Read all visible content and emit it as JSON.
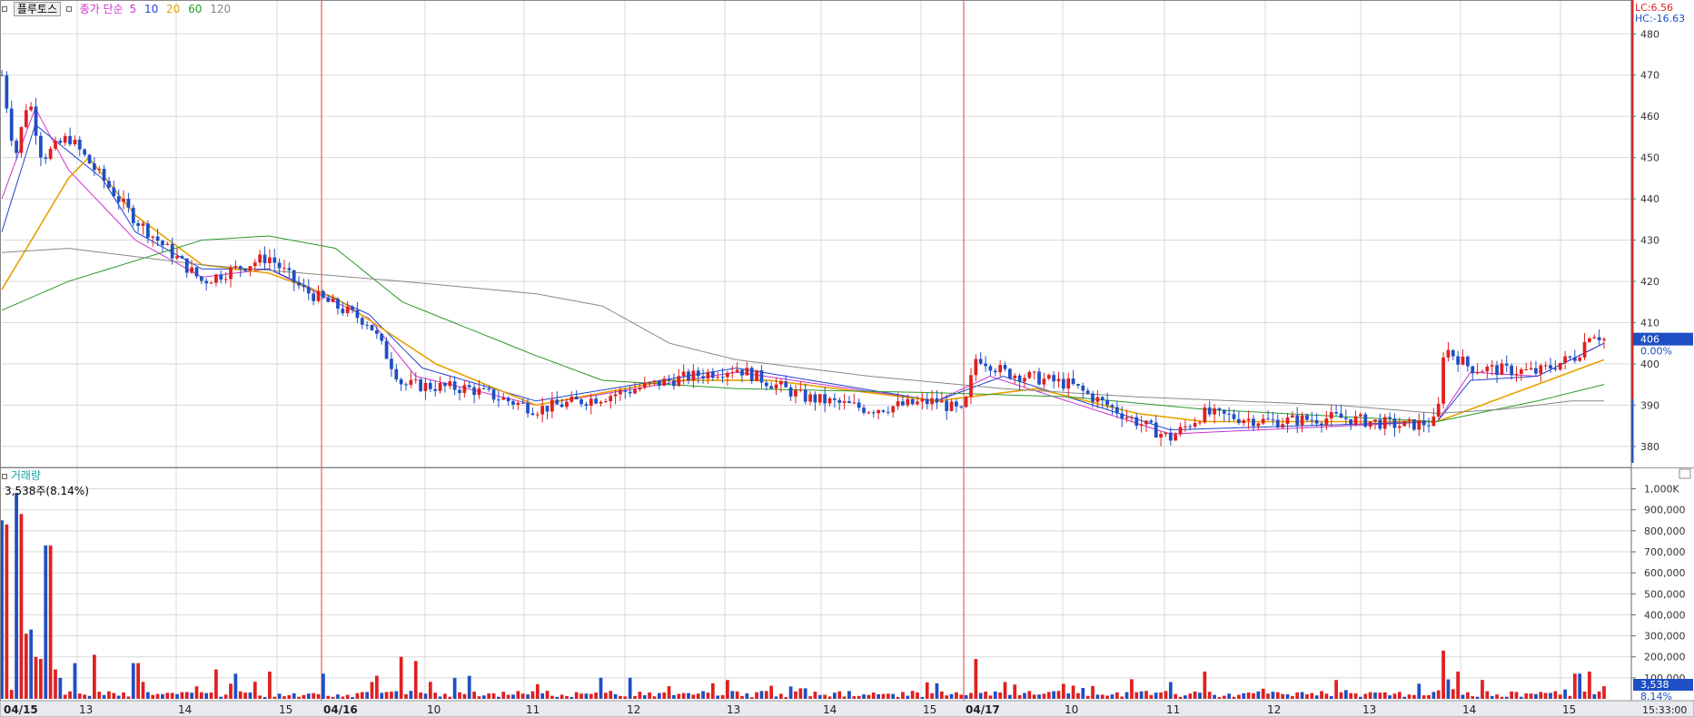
{
  "toolbar": {
    "stock_name": "플루토스",
    "ma_title": "종가 단순",
    "ma_periods": [
      "5",
      "10",
      "20",
      "60",
      "120"
    ],
    "ma_colors": [
      "#cc33cc",
      "#2244cc",
      "#e8a000",
      "#2a9a2a",
      "#888888"
    ]
  },
  "price_axis": {
    "ticks": [
      "480",
      "470",
      "460",
      "450",
      "440",
      "430",
      "420",
      "410",
      "400",
      "390",
      "380"
    ],
    "lc_label": "LC:6.56",
    "hc_label": "HC:-16.63",
    "current_price": "406",
    "current_change": "0.00%"
  },
  "volume_panel": {
    "title": "거래량",
    "current_text": "3,538주(8.14%)",
    "ticks": [
      "1,000K",
      "900,000",
      "800,000",
      "700,000",
      "600,000",
      "500,000",
      "400,000",
      "300,000",
      "200,000",
      "100,000"
    ],
    "current_value": "3,538",
    "current_pct": "8.14%"
  },
  "time_axis": {
    "labels": [
      "04/15",
      "13",
      "14",
      "15",
      "04/16",
      "10",
      "11",
      "12",
      "13",
      "14",
      "15",
      "04/17",
      "10",
      "11",
      "12",
      "13",
      "14",
      "15"
    ],
    "end_time": "15:33:00"
  },
  "colors": {
    "up": "#e02020",
    "down": "#1f4fc4",
    "grid": "#d8d8d8",
    "day_separator": "#e04040"
  },
  "chart_data": {
    "type": "candlestick",
    "ylim": [
      376,
      486
    ],
    "volume_ylim": [
      0,
      1050000
    ],
    "day_separators": [
      "04/16",
      "04/17"
    ],
    "price_anchors": [
      {
        "pos": 0.0,
        "price": 470
      },
      {
        "pos": 0.2,
        "price": 450
      },
      {
        "pos": 0.4,
        "price": 465
      },
      {
        "pos": 0.6,
        "price": 450
      },
      {
        "pos": 1.0,
        "price": 455
      },
      {
        "pos": 2.0,
        "price": 435
      },
      {
        "pos": 3.0,
        "price": 420
      },
      {
        "pos": 4.0,
        "price": 426
      },
      {
        "pos": 4.5,
        "price": 418
      },
      {
        "pos": 5.5,
        "price": 410
      },
      {
        "pos": 6.0,
        "price": 395
      },
      {
        "pos": 7.0,
        "price": 394
      },
      {
        "pos": 8.0,
        "price": 389
      },
      {
        "pos": 9.0,
        "price": 392
      },
      {
        "pos": 10.0,
        "price": 396
      },
      {
        "pos": 11.0,
        "price": 399
      },
      {
        "pos": 12.0,
        "price": 392
      },
      {
        "pos": 13.0,
        "price": 389
      },
      {
        "pos": 14.0,
        "price": 391
      },
      {
        "pos": 14.4,
        "price": 388
      },
      {
        "pos": 14.6,
        "price": 402
      },
      {
        "pos": 15.0,
        "price": 398
      },
      {
        "pos": 16.0,
        "price": 395
      },
      {
        "pos": 17.0,
        "price": 386
      },
      {
        "pos": 17.5,
        "price": 382
      },
      {
        "pos": 18.0,
        "price": 388
      },
      {
        "pos": 19.0,
        "price": 386
      },
      {
        "pos": 20.0,
        "price": 387
      },
      {
        "pos": 21.0,
        "price": 385
      },
      {
        "pos": 21.5,
        "price": 386
      },
      {
        "pos": 21.6,
        "price": 404
      },
      {
        "pos": 22.0,
        "price": 399
      },
      {
        "pos": 23.0,
        "price": 398
      },
      {
        "pos": 23.6,
        "price": 402
      },
      {
        "pos": 23.8,
        "price": 408
      },
      {
        "pos": 24.0,
        "price": 406
      }
    ],
    "ma_anchors": {
      "5": [
        {
          "pos": 0.0,
          "price": 440
        },
        {
          "pos": 0.5,
          "price": 462
        },
        {
          "pos": 1.0,
          "price": 447
        },
        {
          "pos": 2.0,
          "price": 430
        },
        {
          "pos": 3.0,
          "price": 421
        },
        {
          "pos": 4.0,
          "price": 423
        },
        {
          "pos": 5.5,
          "price": 411
        },
        {
          "pos": 6.2,
          "price": 397
        },
        {
          "pos": 8.0,
          "price": 390
        },
        {
          "pos": 11.0,
          "price": 398
        },
        {
          "pos": 14.0,
          "price": 391
        },
        {
          "pos": 14.8,
          "price": 397
        },
        {
          "pos": 17.5,
          "price": 383
        },
        {
          "pos": 21.5,
          "price": 386
        },
        {
          "pos": 22.0,
          "price": 398
        },
        {
          "pos": 23.0,
          "price": 397
        },
        {
          "pos": 24.0,
          "price": 405
        }
      ],
      "10": [
        {
          "pos": 0.0,
          "price": 432
        },
        {
          "pos": 0.5,
          "price": 458
        },
        {
          "pos": 1.5,
          "price": 445
        },
        {
          "pos": 2.0,
          "price": 432
        },
        {
          "pos": 3.0,
          "price": 423
        },
        {
          "pos": 4.0,
          "price": 423
        },
        {
          "pos": 5.5,
          "price": 412
        },
        {
          "pos": 6.3,
          "price": 399
        },
        {
          "pos": 8.0,
          "price": 391
        },
        {
          "pos": 11.0,
          "price": 399
        },
        {
          "pos": 14.0,
          "price": 391
        },
        {
          "pos": 15.0,
          "price": 397
        },
        {
          "pos": 17.5,
          "price": 384
        },
        {
          "pos": 21.5,
          "price": 386
        },
        {
          "pos": 22.0,
          "price": 396
        },
        {
          "pos": 23.0,
          "price": 397
        },
        {
          "pos": 24.0,
          "price": 405
        }
      ],
      "20": [
        {
          "pos": 0.0,
          "price": 418
        },
        {
          "pos": 1.0,
          "price": 445
        },
        {
          "pos": 1.3,
          "price": 450
        },
        {
          "pos": 2.0,
          "price": 436
        },
        {
          "pos": 3.0,
          "price": 424
        },
        {
          "pos": 4.0,
          "price": 422
        },
        {
          "pos": 5.0,
          "price": 416
        },
        {
          "pos": 6.5,
          "price": 400
        },
        {
          "pos": 8.0,
          "price": 390
        },
        {
          "pos": 10.0,
          "price": 396
        },
        {
          "pos": 11.5,
          "price": 396
        },
        {
          "pos": 14.0,
          "price": 391
        },
        {
          "pos": 15.5,
          "price": 394
        },
        {
          "pos": 17.0,
          "price": 388
        },
        {
          "pos": 18.0,
          "price": 386
        },
        {
          "pos": 21.5,
          "price": 386
        },
        {
          "pos": 22.5,
          "price": 392
        },
        {
          "pos": 23.5,
          "price": 398
        },
        {
          "pos": 24.0,
          "price": 401
        }
      ],
      "60": [
        {
          "pos": 0.0,
          "price": 413
        },
        {
          "pos": 1.0,
          "price": 420
        },
        {
          "pos": 3.0,
          "price": 430
        },
        {
          "pos": 4.0,
          "price": 431
        },
        {
          "pos": 5.0,
          "price": 428
        },
        {
          "pos": 6.0,
          "price": 415
        },
        {
          "pos": 8.0,
          "price": 402
        },
        {
          "pos": 9.0,
          "price": 396
        },
        {
          "pos": 11.0,
          "price": 394
        },
        {
          "pos": 14.0,
          "price": 393
        },
        {
          "pos": 16.0,
          "price": 392
        },
        {
          "pos": 18.0,
          "price": 389
        },
        {
          "pos": 21.5,
          "price": 386
        },
        {
          "pos": 23.0,
          "price": 391
        },
        {
          "pos": 24.0,
          "price": 395
        }
      ],
      "120": [
        {
          "pos": 0.0,
          "price": 427
        },
        {
          "pos": 1.0,
          "price": 428
        },
        {
          "pos": 3.0,
          "price": 424
        },
        {
          "pos": 6.0,
          "price": 420
        },
        {
          "pos": 8.0,
          "price": 417
        },
        {
          "pos": 9.0,
          "price": 414
        },
        {
          "pos": 10.0,
          "price": 405
        },
        {
          "pos": 11.0,
          "price": 401
        },
        {
          "pos": 13.0,
          "price": 397
        },
        {
          "pos": 15.0,
          "price": 394
        },
        {
          "pos": 17.0,
          "price": 392
        },
        {
          "pos": 20.0,
          "price": 390
        },
        {
          "pos": 21.5,
          "price": 388
        },
        {
          "pos": 22.5,
          "price": 389
        },
        {
          "pos": 23.5,
          "price": 391
        },
        {
          "pos": 24.0,
          "price": 391
        }
      ]
    },
    "volume_spikes": [
      {
        "pos": 0.0,
        "value": 850000
      },
      {
        "pos": 0.05,
        "value": 400000
      },
      {
        "pos": 0.1,
        "value": 830000
      },
      {
        "pos": 0.15,
        "value": 580000
      },
      {
        "pos": 0.2,
        "value": 480000
      },
      {
        "pos": 0.25,
        "value": 980000
      },
      {
        "pos": 0.3,
        "value": 880000
      },
      {
        "pos": 0.35,
        "value": 390000
      },
      {
        "pos": 0.4,
        "value": 310000
      },
      {
        "pos": 0.45,
        "value": 330000
      },
      {
        "pos": 0.5,
        "value": 250000
      },
      {
        "pos": 0.55,
        "value": 200000
      },
      {
        "pos": 0.6,
        "value": 190000
      },
      {
        "pos": 0.65,
        "value": 240000
      },
      {
        "pos": 0.7,
        "value": 730000
      },
      {
        "pos": 0.8,
        "value": 140000
      },
      {
        "pos": 0.9,
        "value": 120000
      },
      {
        "pos": 1.1,
        "value": 170000
      },
      {
        "pos": 1.4,
        "value": 210000
      },
      {
        "pos": 2.0,
        "value": 170000
      },
      {
        "pos": 3.2,
        "value": 140000
      },
      {
        "pos": 3.5,
        "value": 120000
      },
      {
        "pos": 4.0,
        "value": 130000
      },
      {
        "pos": 4.8,
        "value": 120000
      },
      {
        "pos": 5.6,
        "value": 110000
      },
      {
        "pos": 6.0,
        "value": 200000
      },
      {
        "pos": 6.2,
        "value": 180000
      },
      {
        "pos": 6.4,
        "value": 150000
      },
      {
        "pos": 6.8,
        "value": 100000
      },
      {
        "pos": 8.0,
        "value": 70000
      },
      {
        "pos": 10.0,
        "value": 60000
      },
      {
        "pos": 12.0,
        "value": 50000
      },
      {
        "pos": 14.6,
        "value": 190000
      },
      {
        "pos": 15.0,
        "value": 80000
      },
      {
        "pos": 17.5,
        "value": 80000
      },
      {
        "pos": 18.0,
        "value": 130000
      },
      {
        "pos": 21.6,
        "value": 230000
      },
      {
        "pos": 21.8,
        "value": 130000
      },
      {
        "pos": 22.2,
        "value": 90000
      },
      {
        "pos": 23.6,
        "value": 120000
      },
      {
        "pos": 23.8,
        "value": 130000
      },
      {
        "pos": 24.0,
        "value": 60000
      }
    ]
  }
}
